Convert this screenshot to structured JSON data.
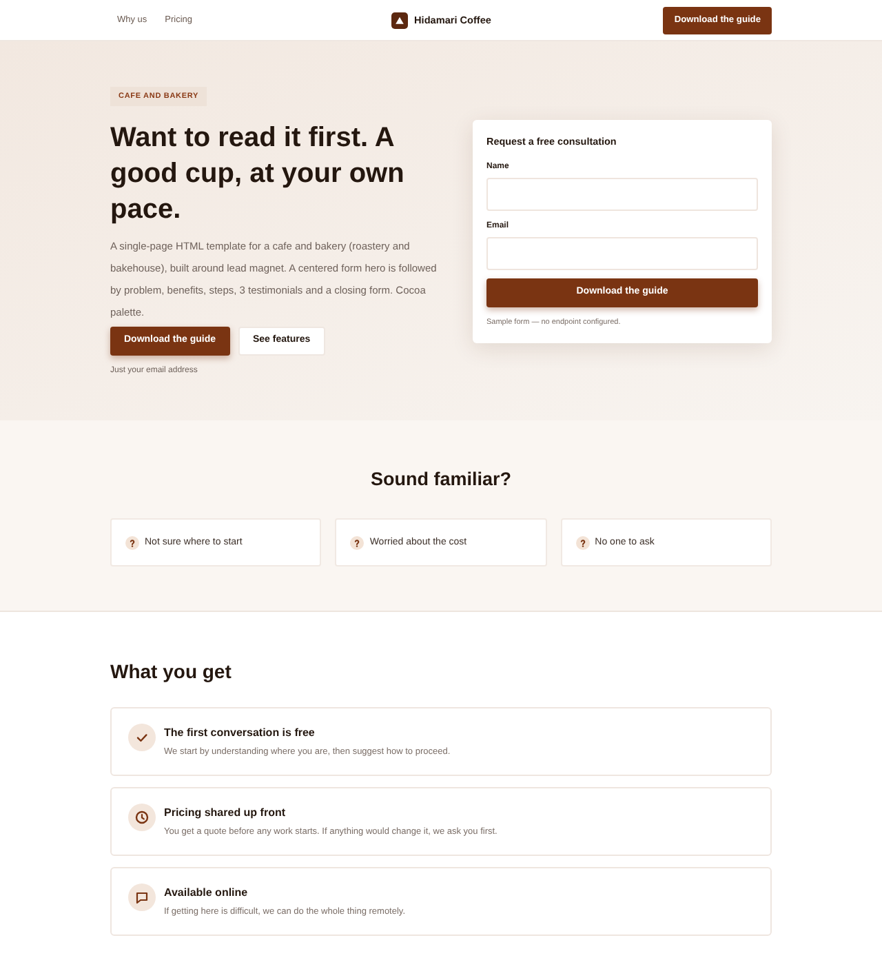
{
  "header": {
    "nav_links": [
      "Why us",
      "Pricing"
    ],
    "brand": "Hidamari Coffee",
    "cta": "Download the guide"
  },
  "hero": {
    "badge": "CAFE AND BAKERY",
    "title": "Want to read it first. A good cup, at your own pace.",
    "description": "A single-page HTML template for a cafe and bakery (roastery and bakehouse), built around lead magnet. A centered form hero is followed by problem, benefits, steps, 3 testimonials and a closing form. Cocoa palette.",
    "buttons": [
      {
        "label": "Download the guide",
        "kind": "primary"
      },
      {
        "label": "See features",
        "kind": "secondary"
      }
    ],
    "note": "Just your email address"
  },
  "form": {
    "title": "Request a free consultation",
    "fields": [
      {
        "label": "Name"
      },
      {
        "label": "Email"
      }
    ],
    "submit": "Download the guide",
    "note": "Sample form — no endpoint configured."
  },
  "problems": {
    "title": "Sound familiar?",
    "items": [
      "Not sure where to start",
      "Worried about the cost",
      "No one to ask"
    ]
  },
  "benefits": {
    "title": "What you get",
    "items": [
      {
        "title": "The first conversation is free",
        "description": "We start by understanding where you are, then suggest how to proceed."
      },
      {
        "title": "Pricing shared up front",
        "description": "You get a quote before any work starts. If anything would change it, we ask you first."
      },
      {
        "title": "Available online",
        "description": "If getting here is difficult, we can do the whole thing remotely."
      }
    ]
  }
}
